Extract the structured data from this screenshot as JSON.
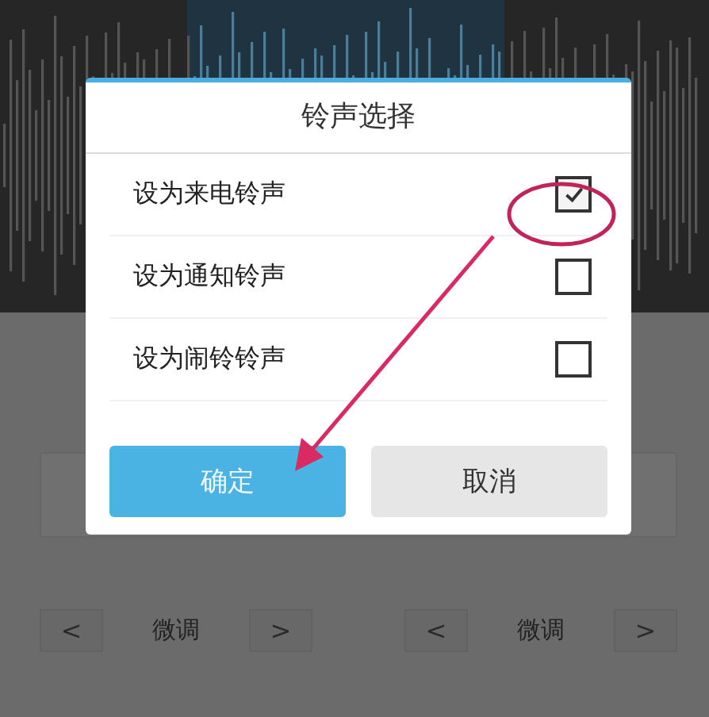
{
  "dialog": {
    "title": "铃声选择",
    "options": [
      {
        "label": "设为来电铃声",
        "checked": true
      },
      {
        "label": "设为通知铃声",
        "checked": false
      },
      {
        "label": "设为闹铃铃声",
        "checked": false
      }
    ],
    "buttons": [
      {
        "label": "确定",
        "kind": "primary"
      },
      {
        "label": "取消",
        "kind": "secondary"
      }
    ]
  },
  "background": {
    "controls": [
      {
        "prev": "<",
        "label": "微调",
        "next": ">"
      },
      {
        "prev": "<",
        "label": "微调",
        "next": ">"
      }
    ]
  }
}
